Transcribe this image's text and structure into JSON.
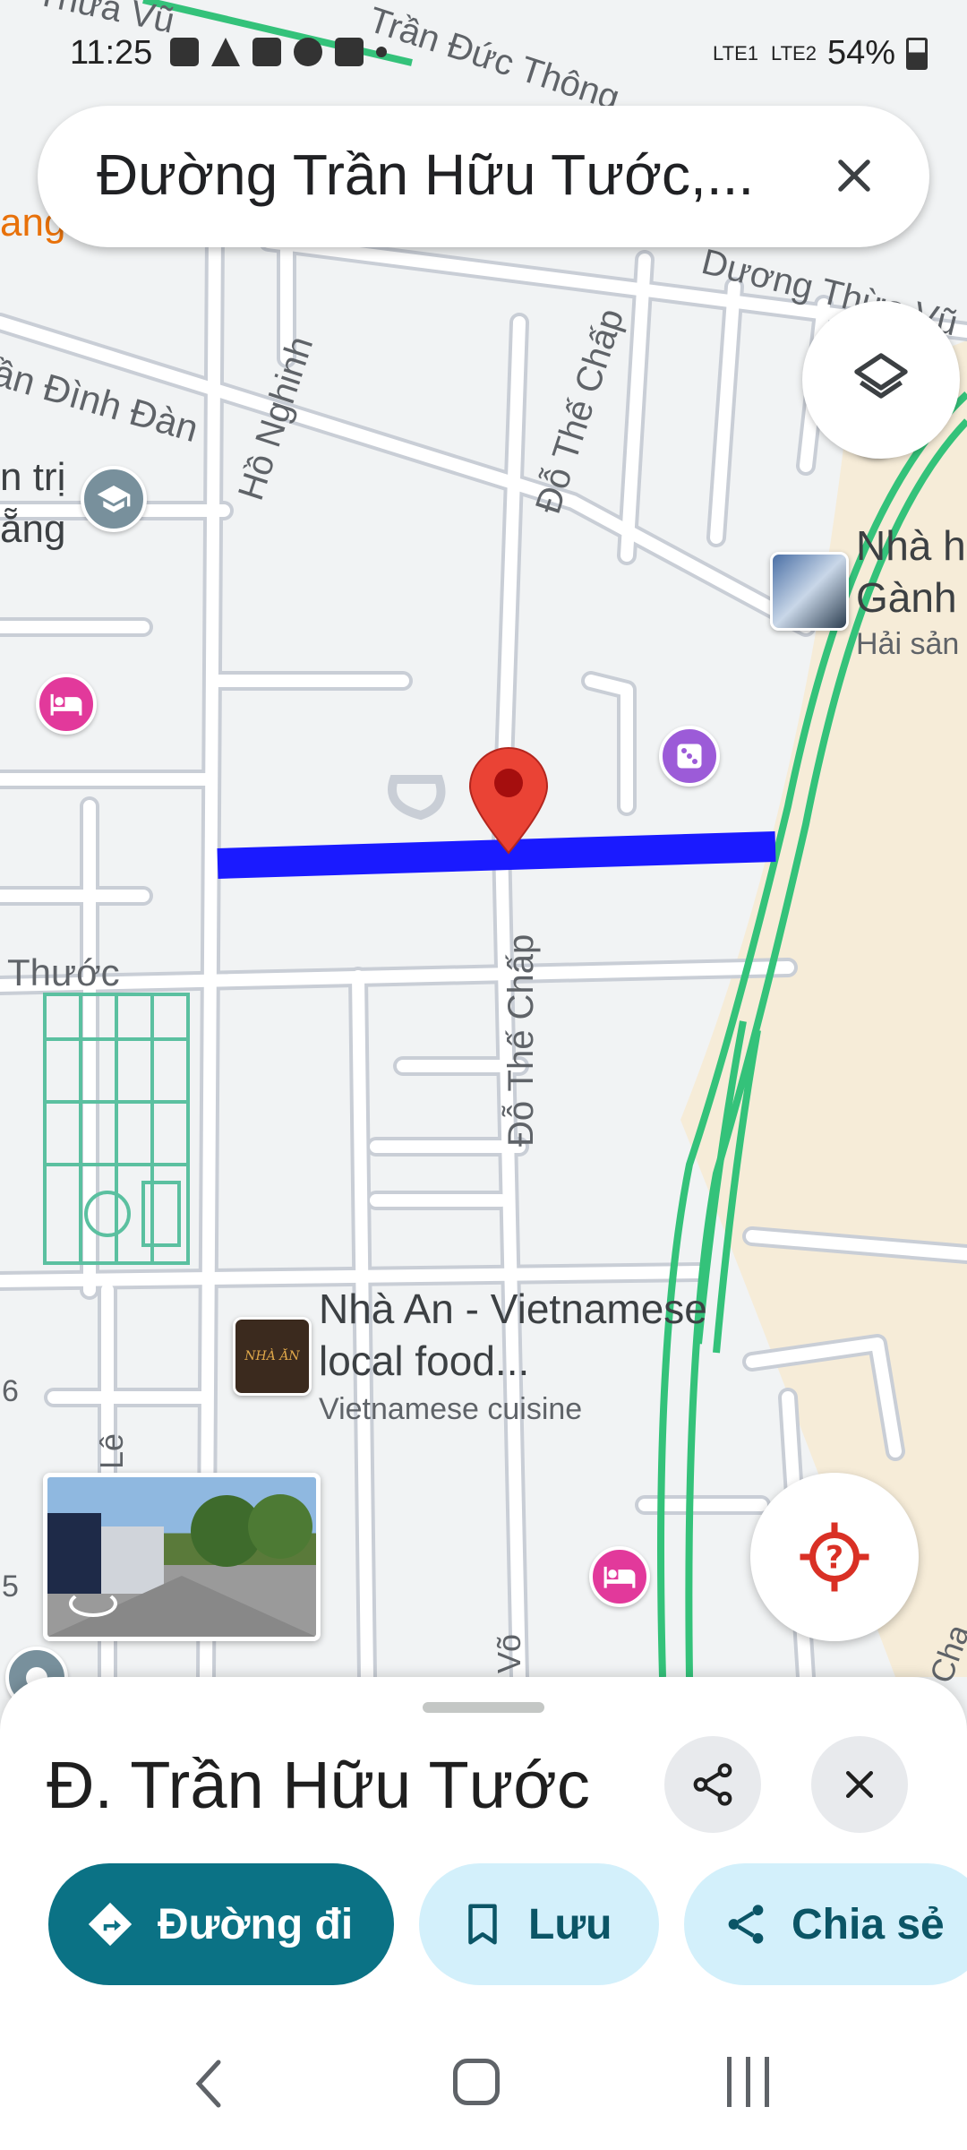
{
  "status_bar": {
    "time": "11:25",
    "battery": "54%",
    "lte1": "LTE1",
    "lte2": "LTE2"
  },
  "search": {
    "query": "Đường Trần Hữu Tước,..."
  },
  "map_labels": {
    "tran_duc_thong": "Trần Đức Thông",
    "thua_vu_top": "Thừa Vũ",
    "duong_thua_vu": "Dương Thừa Vũ",
    "ang": "ang",
    "tran_dinh_dan": "ần Đình Đàn",
    "ho_nghinh": "Hồ Nghinh",
    "do_the_chap_top": "Đỗ Thế Chấp",
    "do_the_chap_mid": "Đỗ Thế Chấp",
    "n_tri": "n trị",
    "ang2": "ẵng",
    "thuoc": "Thước",
    "le": "Lê",
    "vo": "Võ",
    "num_6": "6",
    "num_5": "5",
    "chap_edge": "Chạ"
  },
  "places": {
    "seafood_name_1": "Nhà h",
    "seafood_name_2": "Gành",
    "seafood_sub": "Hải sản",
    "nha_an_name_1": "Nhà An - Vietnamese",
    "nha_an_name_2": "local food...",
    "nha_an_sub": "Vietnamese cuisine",
    "nha_an_thumb_text": "NHÀ ĂN"
  },
  "sheet": {
    "title": "Đ. Trần Hữu Tước",
    "directions_label": "Đường đi",
    "save_label": "Lưu",
    "share_label": "Chia sẻ"
  },
  "colors": {
    "route": "#1a1aff",
    "pin": "#ea4335",
    "teal": "#0b7285",
    "pill_bg": "#d3f0fb",
    "highway": "#34c27a"
  },
  "icons": [
    "layers-icon",
    "close-icon",
    "share-icon",
    "directions-icon",
    "bookmark-icon",
    "my-location-icon",
    "hotel-icon",
    "restaurant-icon",
    "school-icon",
    "dice-icon"
  ]
}
